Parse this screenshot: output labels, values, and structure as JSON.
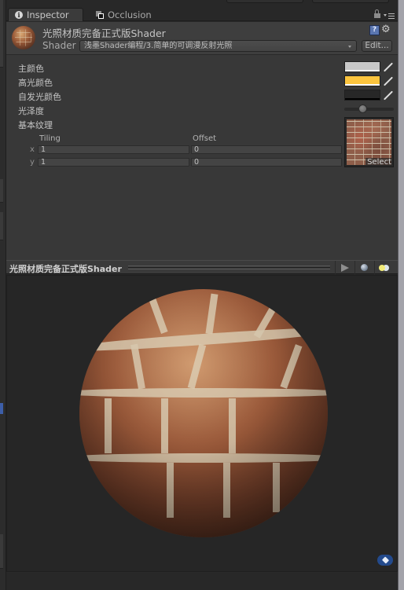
{
  "tabs": [
    {
      "label": "Inspector",
      "icon": "info-icon",
      "active": true
    },
    {
      "label": "Occlusion",
      "icon": "occlusion-icon",
      "active": false
    }
  ],
  "header": {
    "material_name": "光照材质完备正式版Shader",
    "shader_label": "Shader",
    "shader_value": "浅墨Shader编程/3.简单的可调漫反射光照",
    "edit_label": "Edit..."
  },
  "properties": {
    "main_color": {
      "label": "主颜色",
      "color": "#c8c8c8"
    },
    "specular_color": {
      "label": "高光颜色",
      "color": "#fbc43e"
    },
    "emission_color": {
      "label": "自发光颜色",
      "color": "#272727"
    },
    "shininess": {
      "label": "光泽度",
      "value_fraction": 0.35
    },
    "base_texture": {
      "label": "基本纹理",
      "select_label": "Select",
      "tiling_label": "Tiling",
      "offset_label": "Offset",
      "x_label": "x",
      "y_label": "y",
      "tiling_x": "1",
      "tiling_y": "1",
      "offset_x": "0",
      "offset_y": "0"
    }
  },
  "preview": {
    "title": "光照材质完备正式版Shader"
  }
}
